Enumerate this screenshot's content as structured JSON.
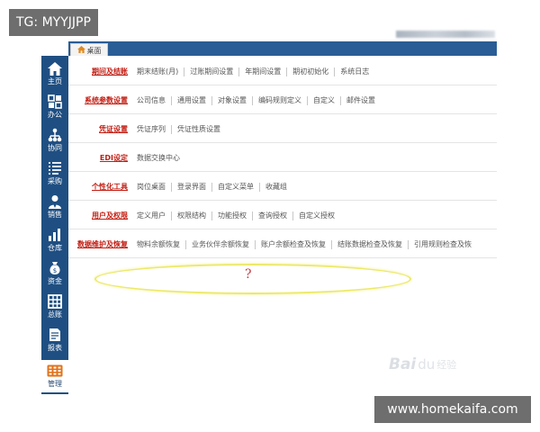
{
  "overlays": {
    "tag": "TG: MYYJJPP",
    "site": "www.homekaifa.com"
  },
  "header": {
    "desk_tab_label": "桌面",
    "desk_tab_icon": "home-icon"
  },
  "sidebar": {
    "items": [
      {
        "label": "主页",
        "icon": "home-icon"
      },
      {
        "label": "办公",
        "icon": "office-grid-icon"
      },
      {
        "label": "协同",
        "icon": "collaboration-tree-icon"
      },
      {
        "label": "采购",
        "icon": "purchase-list-icon"
      },
      {
        "label": "销售",
        "icon": "sales-person-icon"
      },
      {
        "label": "仓库",
        "icon": "warehouse-bars-icon"
      },
      {
        "label": "资金",
        "icon": "money-bag-icon"
      },
      {
        "label": "总账",
        "icon": "ledger-grid-icon"
      },
      {
        "label": "报表",
        "icon": "report-icon"
      },
      {
        "label": "管理",
        "icon": "management-calculator-icon",
        "active": true
      }
    ]
  },
  "sections": [
    {
      "title": "期间及结账",
      "links": [
        "期末结账(月)",
        "过账期间设置",
        "年期间设置",
        "期初初始化",
        "系统日志"
      ]
    },
    {
      "title": "系统参数设置",
      "links": [
        "公司信息",
        "通用设置",
        "对象设置",
        "编码规则定义",
        "自定义",
        "邮件设置"
      ]
    },
    {
      "title": "凭证设置",
      "links": [
        "凭证序列",
        "凭证性质设置"
      ]
    },
    {
      "title": "EDI设定",
      "links": [
        "数据交换中心"
      ]
    },
    {
      "title": "个性化工具",
      "links": [
        "岗位桌面",
        "登录界面",
        "自定义菜单",
        "收藏组"
      ]
    },
    {
      "title": "用户及权限",
      "links": [
        "定义用户",
        "权限结构",
        "功能授权",
        "查询授权",
        "自定义授权"
      ]
    },
    {
      "title": "数据维护及恢复",
      "links": [
        "物料余额恢复",
        "业务伙伴余额恢复",
        "账户余额检查及恢复",
        "结账数据检查及恢复",
        "引用规则检查及恢"
      ]
    }
  ],
  "annotation": {
    "question_mark": "?"
  },
  "watermark": {
    "text": "Bai",
    "paw": "du",
    "cn": "经验"
  },
  "colors": {
    "sidebar": "#1f4f82",
    "topbar": "#2a5d95",
    "section_title": "#c21d12",
    "highlight_ellipse": "#ece96a",
    "question_mark": "#c43d42"
  }
}
